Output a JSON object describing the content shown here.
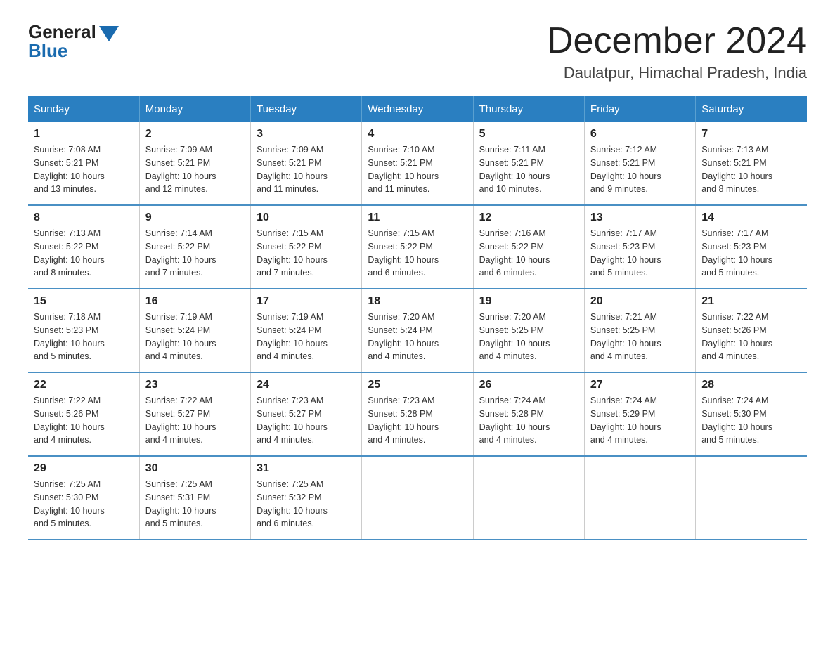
{
  "logo": {
    "general": "General",
    "blue": "Blue"
  },
  "title": "December 2024",
  "subtitle": "Daulatpur, Himachal Pradesh, India",
  "days_of_week": [
    "Sunday",
    "Monday",
    "Tuesday",
    "Wednesday",
    "Thursday",
    "Friday",
    "Saturday"
  ],
  "weeks": [
    [
      {
        "day": "1",
        "info": "Sunrise: 7:08 AM\nSunset: 5:21 PM\nDaylight: 10 hours\nand 13 minutes."
      },
      {
        "day": "2",
        "info": "Sunrise: 7:09 AM\nSunset: 5:21 PM\nDaylight: 10 hours\nand 12 minutes."
      },
      {
        "day": "3",
        "info": "Sunrise: 7:09 AM\nSunset: 5:21 PM\nDaylight: 10 hours\nand 11 minutes."
      },
      {
        "day": "4",
        "info": "Sunrise: 7:10 AM\nSunset: 5:21 PM\nDaylight: 10 hours\nand 11 minutes."
      },
      {
        "day": "5",
        "info": "Sunrise: 7:11 AM\nSunset: 5:21 PM\nDaylight: 10 hours\nand 10 minutes."
      },
      {
        "day": "6",
        "info": "Sunrise: 7:12 AM\nSunset: 5:21 PM\nDaylight: 10 hours\nand 9 minutes."
      },
      {
        "day": "7",
        "info": "Sunrise: 7:13 AM\nSunset: 5:21 PM\nDaylight: 10 hours\nand 8 minutes."
      }
    ],
    [
      {
        "day": "8",
        "info": "Sunrise: 7:13 AM\nSunset: 5:22 PM\nDaylight: 10 hours\nand 8 minutes."
      },
      {
        "day": "9",
        "info": "Sunrise: 7:14 AM\nSunset: 5:22 PM\nDaylight: 10 hours\nand 7 minutes."
      },
      {
        "day": "10",
        "info": "Sunrise: 7:15 AM\nSunset: 5:22 PM\nDaylight: 10 hours\nand 7 minutes."
      },
      {
        "day": "11",
        "info": "Sunrise: 7:15 AM\nSunset: 5:22 PM\nDaylight: 10 hours\nand 6 minutes."
      },
      {
        "day": "12",
        "info": "Sunrise: 7:16 AM\nSunset: 5:22 PM\nDaylight: 10 hours\nand 6 minutes."
      },
      {
        "day": "13",
        "info": "Sunrise: 7:17 AM\nSunset: 5:23 PM\nDaylight: 10 hours\nand 5 minutes."
      },
      {
        "day": "14",
        "info": "Sunrise: 7:17 AM\nSunset: 5:23 PM\nDaylight: 10 hours\nand 5 minutes."
      }
    ],
    [
      {
        "day": "15",
        "info": "Sunrise: 7:18 AM\nSunset: 5:23 PM\nDaylight: 10 hours\nand 5 minutes."
      },
      {
        "day": "16",
        "info": "Sunrise: 7:19 AM\nSunset: 5:24 PM\nDaylight: 10 hours\nand 4 minutes."
      },
      {
        "day": "17",
        "info": "Sunrise: 7:19 AM\nSunset: 5:24 PM\nDaylight: 10 hours\nand 4 minutes."
      },
      {
        "day": "18",
        "info": "Sunrise: 7:20 AM\nSunset: 5:24 PM\nDaylight: 10 hours\nand 4 minutes."
      },
      {
        "day": "19",
        "info": "Sunrise: 7:20 AM\nSunset: 5:25 PM\nDaylight: 10 hours\nand 4 minutes."
      },
      {
        "day": "20",
        "info": "Sunrise: 7:21 AM\nSunset: 5:25 PM\nDaylight: 10 hours\nand 4 minutes."
      },
      {
        "day": "21",
        "info": "Sunrise: 7:22 AM\nSunset: 5:26 PM\nDaylight: 10 hours\nand 4 minutes."
      }
    ],
    [
      {
        "day": "22",
        "info": "Sunrise: 7:22 AM\nSunset: 5:26 PM\nDaylight: 10 hours\nand 4 minutes."
      },
      {
        "day": "23",
        "info": "Sunrise: 7:22 AM\nSunset: 5:27 PM\nDaylight: 10 hours\nand 4 minutes."
      },
      {
        "day": "24",
        "info": "Sunrise: 7:23 AM\nSunset: 5:27 PM\nDaylight: 10 hours\nand 4 minutes."
      },
      {
        "day": "25",
        "info": "Sunrise: 7:23 AM\nSunset: 5:28 PM\nDaylight: 10 hours\nand 4 minutes."
      },
      {
        "day": "26",
        "info": "Sunrise: 7:24 AM\nSunset: 5:28 PM\nDaylight: 10 hours\nand 4 minutes."
      },
      {
        "day": "27",
        "info": "Sunrise: 7:24 AM\nSunset: 5:29 PM\nDaylight: 10 hours\nand 4 minutes."
      },
      {
        "day": "28",
        "info": "Sunrise: 7:24 AM\nSunset: 5:30 PM\nDaylight: 10 hours\nand 5 minutes."
      }
    ],
    [
      {
        "day": "29",
        "info": "Sunrise: 7:25 AM\nSunset: 5:30 PM\nDaylight: 10 hours\nand 5 minutes."
      },
      {
        "day": "30",
        "info": "Sunrise: 7:25 AM\nSunset: 5:31 PM\nDaylight: 10 hours\nand 5 minutes."
      },
      {
        "day": "31",
        "info": "Sunrise: 7:25 AM\nSunset: 5:32 PM\nDaylight: 10 hours\nand 6 minutes."
      },
      null,
      null,
      null,
      null
    ]
  ]
}
